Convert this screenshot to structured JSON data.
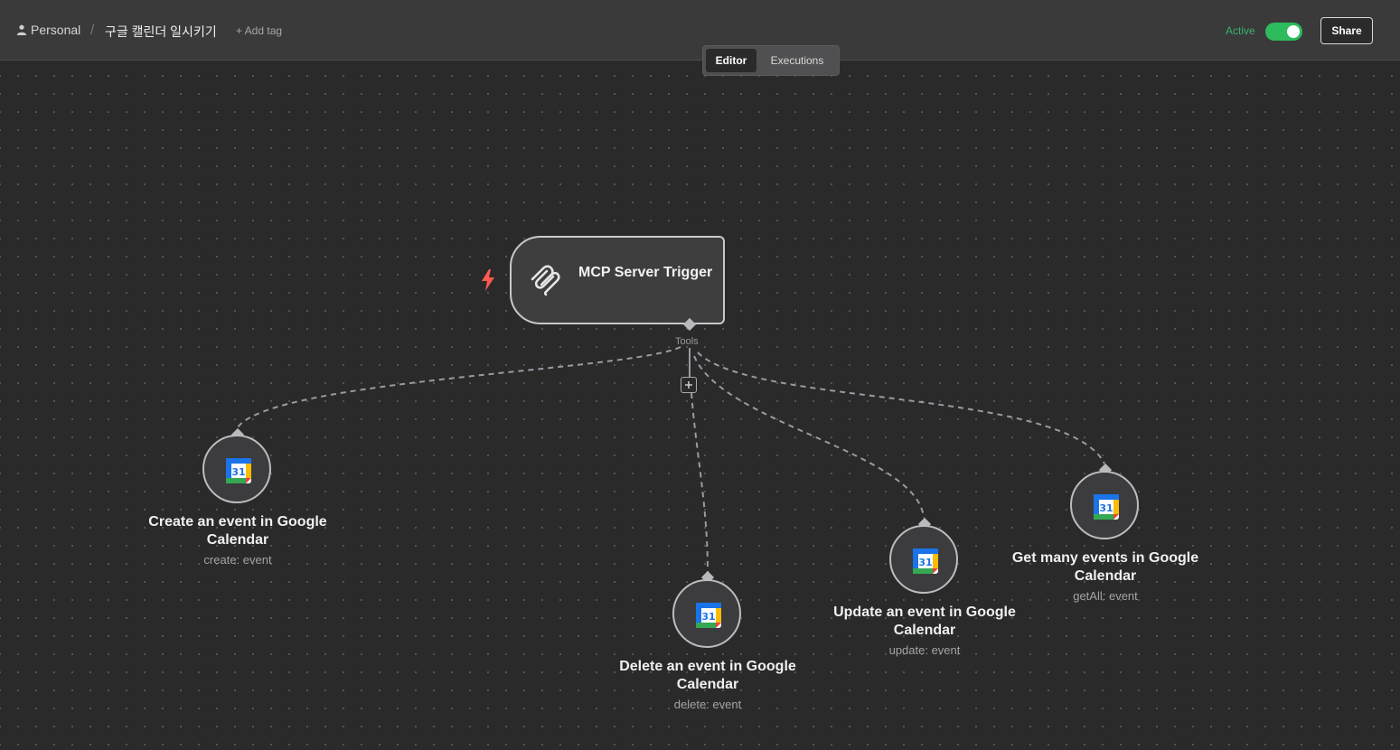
{
  "header": {
    "workspace": "Personal",
    "separator": "/",
    "workflow_name": "구글 캘린더 일시키기",
    "add_tag": "+ Add tag",
    "active_label": "Active",
    "active": true,
    "share_label": "Share"
  },
  "tabs": [
    "Editor",
    "Executions"
  ],
  "active_tab": "Editor",
  "trigger": {
    "title": "MCP Server Trigger",
    "connector_label": "Tools"
  },
  "tools": [
    {
      "title": "Create an event in Google Calendar",
      "subtitle": "create: event"
    },
    {
      "title": "Delete an event in Google Calendar",
      "subtitle": "delete: event"
    },
    {
      "title": "Update an event in Google Calendar",
      "subtitle": "update: event"
    },
    {
      "title": "Get many events in Google Calendar",
      "subtitle": "getAll: event"
    }
  ],
  "colors": {
    "active_green": "#2dbb5d",
    "trigger_bolt": "#ff5a4e"
  },
  "icons": {
    "tool": "google-calendar-icon",
    "trigger": "mcp-icon"
  }
}
